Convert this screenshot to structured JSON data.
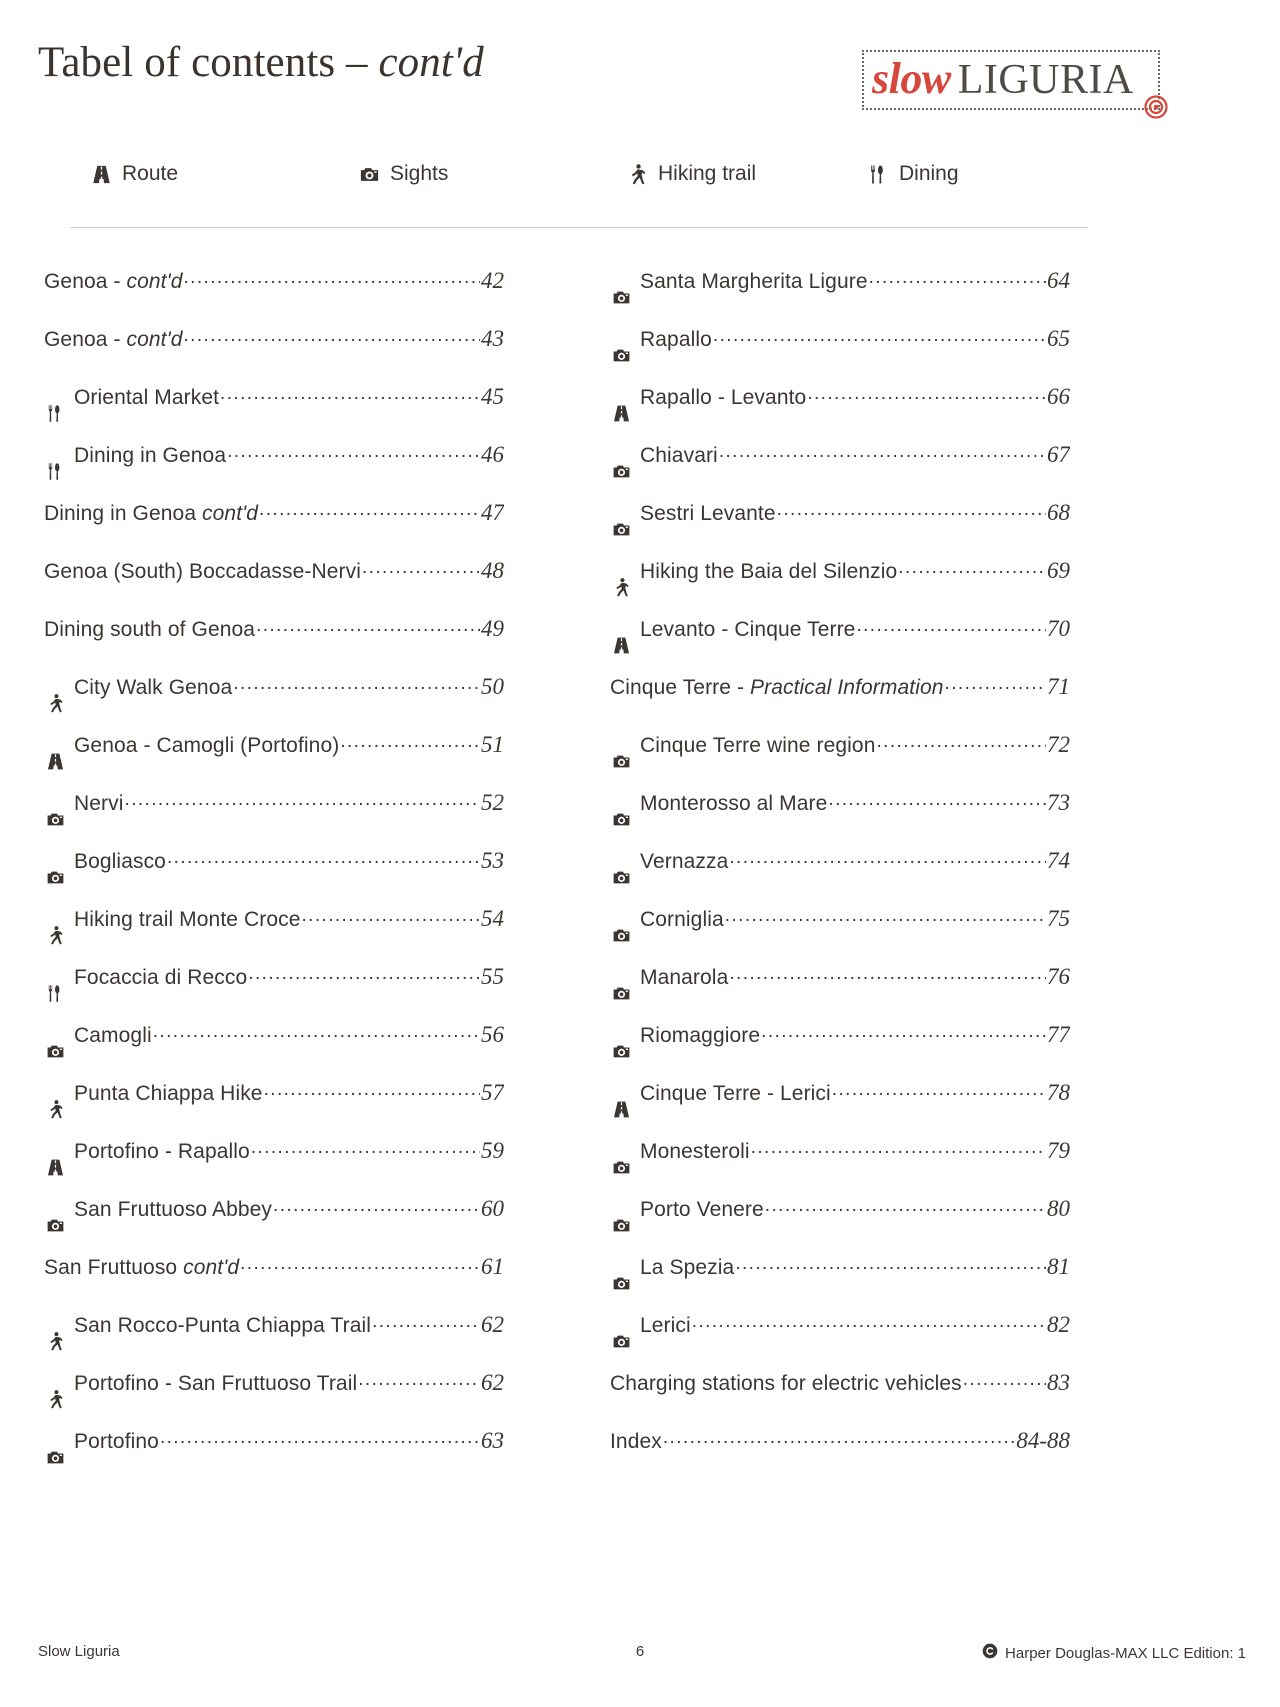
{
  "header": {
    "title_main": "Tabel of contents – ",
    "title_contd": "cont'd",
    "logo": {
      "word_slow": "slow",
      "word_liguria": "LIGURIA",
      "target_icon": "target-icon",
      "slow_color": "#d6483b",
      "liguria_color": "#4f4a45"
    }
  },
  "legend": [
    {
      "icon": "road-icon",
      "label": "Route"
    },
    {
      "icon": "camera-icon",
      "label": "Sights"
    },
    {
      "icon": "walking-icon",
      "label": "Hiking trail"
    },
    {
      "icon": "cutlery-icon",
      "label": "Dining"
    }
  ],
  "columns": {
    "left": [
      {
        "icon": "none",
        "label": "Genoa - ",
        "label_italic": "cont'd",
        "page": "42"
      },
      {
        "icon": "none",
        "label": "Genoa - ",
        "label_italic": "cont'd",
        "page": "43"
      },
      {
        "icon": "cutlery-icon",
        "label": "Oriental Market",
        "label_italic": "",
        "page": "45"
      },
      {
        "icon": "cutlery-icon",
        "label": "Dining in Genoa",
        "label_italic": "",
        "page": "46"
      },
      {
        "icon": "none",
        "label": "Dining in Genoa ",
        "label_italic": "cont'd",
        "page": "47"
      },
      {
        "icon": "none",
        "label": "Genoa (South) Boccadasse-Nervi",
        "label_italic": "",
        "page": "48"
      },
      {
        "icon": "none",
        "label": "Dining south of Genoa ",
        "label_italic": "",
        "page": "49"
      },
      {
        "icon": "walking-icon",
        "label": "City Walk Genoa",
        "label_italic": "",
        "page": "50"
      },
      {
        "icon": "road-icon",
        "label": "Genoa - Camogli (Portofino)",
        "label_italic": "",
        "page": "51"
      },
      {
        "icon": "camera-icon",
        "label": "Nervi",
        "label_italic": "",
        "page": "52"
      },
      {
        "icon": "camera-icon",
        "label": "Bogliasco",
        "label_italic": "",
        "page": "53"
      },
      {
        "icon": "walking-icon",
        "label": "Hiking trail Monte Croce ",
        "label_italic": "",
        "page": "54"
      },
      {
        "icon": "cutlery-icon",
        "label": "Focaccia di Recco ",
        "label_italic": "",
        "page": "55"
      },
      {
        "icon": "camera-icon",
        "label": "Camogli",
        "label_italic": "",
        "page": "56"
      },
      {
        "icon": "walking-icon",
        "label": "Punta Chiappa Hike ",
        "label_italic": "",
        "page": "57"
      },
      {
        "icon": "road-icon",
        "label": "Portofino - Rapallo ",
        "label_italic": "",
        "page": "59"
      },
      {
        "icon": "camera-icon",
        "label": "San Fruttuoso Abbey ",
        "label_italic": "",
        "page": "60"
      },
      {
        "icon": "none",
        "label": "San Fruttuoso ",
        "label_italic": "cont'd",
        "page": "61"
      },
      {
        "icon": "walking-icon",
        "label": "San Rocco-Punta Chiappa Trail",
        "label_italic": "",
        "page": "62"
      },
      {
        "icon": "walking-icon",
        "label": "Portofino - San Fruttuoso Trail",
        "label_italic": "",
        "page": "62"
      },
      {
        "icon": "camera-icon",
        "label": "Portofino",
        "label_italic": "",
        "page": "63"
      }
    ],
    "right": [
      {
        "icon": "camera-icon",
        "label": "Santa Margherita Ligure ",
        "label_italic": "",
        "page": "64"
      },
      {
        "icon": "camera-icon",
        "label": "Rapallo ",
        "label_italic": "",
        "page": "65"
      },
      {
        "icon": "road-icon",
        "label": "Rapallo - Levanto ",
        "label_italic": "",
        "page": "66"
      },
      {
        "icon": "camera-icon",
        "label": "Chiavari ",
        "label_italic": "",
        "page": "67"
      },
      {
        "icon": "camera-icon",
        "label": "Sestri Levante",
        "label_italic": "",
        "page": "68"
      },
      {
        "icon": "walking-icon",
        "label": "Hiking the Baia del Silenzio ",
        "label_italic": "",
        "page": "69"
      },
      {
        "icon": "road-icon",
        "label": "Levanto - Cinque Terre",
        "label_italic": "",
        "page": "70"
      },
      {
        "icon": "none",
        "label": "Cinque Terre - ",
        "label_italic": "Practical Information",
        "page": "71"
      },
      {
        "icon": "camera-icon",
        "label": "Cinque Terre wine region",
        "label_italic": "",
        "page": "72"
      },
      {
        "icon": "camera-icon",
        "label": "Monterosso al Mare",
        "label_italic": "",
        "page": "73"
      },
      {
        "icon": "camera-icon",
        "label": " Vernazza",
        "label_italic": "",
        "page": "74"
      },
      {
        "icon": "camera-icon",
        "label": "Corniglia",
        "label_italic": "",
        "page": "75"
      },
      {
        "icon": "camera-icon",
        "label": "Manarola ",
        "label_italic": "",
        "page": "76"
      },
      {
        "icon": "camera-icon",
        "label": "Riomaggiore",
        "label_italic": "",
        "page": "77"
      },
      {
        "icon": "road-icon",
        "label": "Cinque Terre - Lerici ",
        "label_italic": "",
        "page": "78"
      },
      {
        "icon": "camera-icon",
        "label": "Monesteroli ",
        "label_italic": "",
        "page": "79"
      },
      {
        "icon": "camera-icon",
        "label": "Porto Venere ",
        "label_italic": "",
        "page": "80"
      },
      {
        "icon": "camera-icon",
        "label": "La Spezia",
        "label_italic": "",
        "page": "81"
      },
      {
        "icon": "camera-icon",
        "label": "Lerici",
        "label_italic": "",
        "page": "82"
      },
      {
        "icon": "none",
        "label": "Charging stations for electric vehicles ",
        "label_italic": "",
        "page": "83"
      },
      {
        "icon": "none",
        "label": "Index",
        "label_italic": "",
        "page": "84-88"
      }
    ]
  },
  "footer": {
    "left": "Slow Liguria",
    "center": "6",
    "copyright_icon": "copyright-icon",
    "right": "Harper Douglas-MAX LLC Edition: 1"
  }
}
